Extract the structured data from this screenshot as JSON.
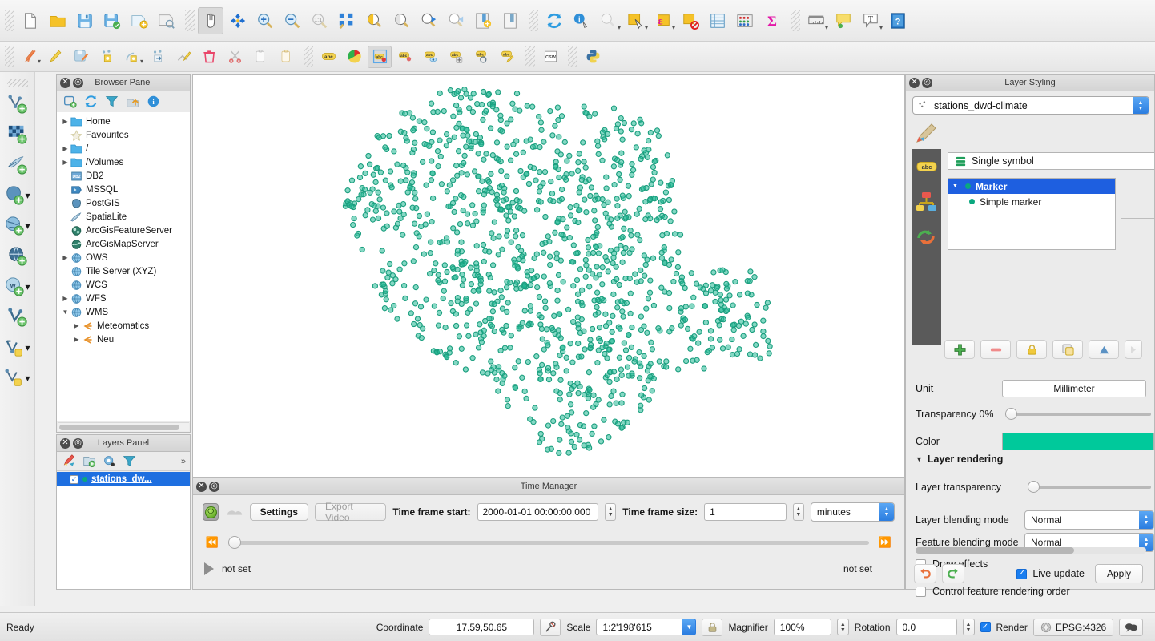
{
  "toolbar_row_1": [
    {
      "name": "new-project-icon",
      "label": "New Project"
    },
    {
      "name": "open-project-icon",
      "label": "Open Project"
    },
    {
      "name": "save-project-icon",
      "label": "Save Project"
    },
    {
      "name": "save-project-as-icon",
      "label": "Save Project As"
    },
    {
      "name": "new-print-composer-icon",
      "label": "New Print Composer"
    },
    {
      "name": "composer-manager-icon",
      "label": "Composer Manager"
    },
    {
      "name": "pan-map-icon",
      "label": "Pan Map"
    },
    {
      "name": "pan-to-selection-icon",
      "label": "Pan Map to Selection"
    },
    {
      "name": "zoom-in-icon",
      "label": "Zoom In"
    },
    {
      "name": "zoom-out-icon",
      "label": "Zoom Out"
    },
    {
      "name": "zoom-native-icon",
      "label": "Zoom to Native Resolution"
    },
    {
      "name": "zoom-full-icon",
      "label": "Zoom Full"
    },
    {
      "name": "zoom-to-selection-icon",
      "label": "Zoom to Selection"
    },
    {
      "name": "zoom-to-layer-icon",
      "label": "Zoom to Layer"
    },
    {
      "name": "zoom-last-icon",
      "label": "Zoom Last"
    },
    {
      "name": "zoom-next-icon",
      "label": "Zoom Next"
    },
    {
      "name": "new-bookmark-icon",
      "label": "New Bookmark"
    },
    {
      "name": "show-bookmarks-icon",
      "label": "Show Bookmarks"
    },
    {
      "name": "refresh-icon",
      "label": "Refresh"
    },
    {
      "name": "identify-features-icon",
      "label": "Identify Features"
    },
    {
      "name": "measure-line-icon",
      "label": "Measure Line"
    },
    {
      "name": "select-features-icon",
      "label": "Select Features"
    },
    {
      "name": "select-by-expression-icon",
      "label": "Select by Expression"
    },
    {
      "name": "deselect-features-icon",
      "label": "Deselect Features"
    },
    {
      "name": "open-attribute-table-icon",
      "label": "Open Attribute Table"
    },
    {
      "name": "field-calculator-icon",
      "label": "Open Field Calculator"
    },
    {
      "name": "statistical-summary-icon",
      "label": "Statistical Summary"
    },
    {
      "name": "measure-icon",
      "label": "Measure"
    },
    {
      "name": "map-tips-icon",
      "label": "Show Map Tips"
    },
    {
      "name": "text-annotation-icon",
      "label": "Text Annotation"
    },
    {
      "name": "help-icon",
      "label": "Help"
    }
  ],
  "toolbar_row_2": [
    {
      "name": "current-edits-icon",
      "label": "Current Edits"
    },
    {
      "name": "toggle-editing-icon",
      "label": "Toggle Editing"
    },
    {
      "name": "save-layer-edits-icon",
      "label": "Save Layer Edits"
    },
    {
      "name": "add-feature-icon",
      "label": "Add Feature"
    },
    {
      "name": "node-tool-icon",
      "label": "Node Tool"
    },
    {
      "name": "move-feature-icon",
      "label": "Move Feature"
    },
    {
      "name": "modify-attributes-icon",
      "label": "Modify Attributes of Selected Features"
    },
    {
      "name": "delete-selected-icon",
      "label": "Delete Selected"
    },
    {
      "name": "cut-features-icon",
      "label": "Cut Features"
    },
    {
      "name": "copy-features-icon",
      "label": "Copy Features"
    },
    {
      "name": "paste-features-icon",
      "label": "Paste Features"
    },
    {
      "name": "label-icon",
      "label": "Layer Labeling Options"
    },
    {
      "name": "style-manager-icon",
      "label": "Style Manager"
    },
    {
      "name": "highlight-pinned-labels-icon",
      "label": "Highlight Pinned Labels"
    },
    {
      "name": "pin-labels-icon",
      "label": "Pin/Unpin Labels"
    },
    {
      "name": "show-hide-labels-icon",
      "label": "Show/Hide Labels"
    },
    {
      "name": "move-label-icon",
      "label": "Move Label"
    },
    {
      "name": "rotate-label-icon",
      "label": "Rotate Label"
    },
    {
      "name": "change-label-icon",
      "label": "Change Label"
    },
    {
      "name": "csw-icon",
      "label": "MetaSearch (CSW)"
    },
    {
      "name": "python-console-icon",
      "label": "Python Console"
    }
  ],
  "left_toolbar": [
    {
      "name": "add-vector-layer-icon",
      "label": "Add Vector Layer"
    },
    {
      "name": "add-raster-layer-icon",
      "label": "Add Raster Layer"
    },
    {
      "name": "add-delimited-text-layer-icon",
      "label": "Add Delimited Text Layer"
    },
    {
      "name": "add-postgis-layer-icon",
      "label": "Add PostGIS Layer"
    },
    {
      "name": "add-spatialite-layer-icon",
      "label": "Add SpatiaLite Layer"
    },
    {
      "name": "add-wms-layer-icon",
      "label": "Add WMS/WMTS Layer"
    },
    {
      "name": "add-wcs-layer-icon",
      "label": "Add WCS Layer"
    },
    {
      "name": "add-wfs-layer-icon",
      "label": "Add WFS Layer"
    },
    {
      "name": "add-virtual-layer-icon",
      "label": "Add Virtual Layer"
    },
    {
      "name": "new-shapefile-layer-icon",
      "label": "New Shapefile Layer"
    }
  ],
  "browser_panel": {
    "title": "Browser Panel",
    "toolbar": [
      {
        "name": "add-selected-layers-icon",
        "label": "Add Selected Layers"
      },
      {
        "name": "refresh-icon",
        "label": "Refresh"
      },
      {
        "name": "filter-browser-icon",
        "label": "Filter Browser"
      },
      {
        "name": "collapse-all-icon",
        "label": "Collapse All"
      },
      {
        "name": "properties-icon",
        "label": "Properties"
      }
    ],
    "tree": [
      {
        "label": "Home",
        "icon": "folder-icon",
        "twisty": "collapsed",
        "indent": 0
      },
      {
        "label": "Favourites",
        "icon": "star-icon",
        "twisty": "none",
        "indent": 0
      },
      {
        "label": "/",
        "icon": "folder-icon",
        "twisty": "collapsed",
        "indent": 0
      },
      {
        "label": "/Volumes",
        "icon": "folder-icon",
        "twisty": "collapsed",
        "indent": 0
      },
      {
        "label": "DB2",
        "icon": "db2-icon",
        "twisty": "none",
        "indent": 0
      },
      {
        "label": "MSSQL",
        "icon": "mssql-icon",
        "twisty": "none",
        "indent": 0
      },
      {
        "label": "PostGIS",
        "icon": "postgis-icon",
        "twisty": "none",
        "indent": 0
      },
      {
        "label": "SpatiaLite",
        "icon": "spatialite-icon",
        "twisty": "none",
        "indent": 0
      },
      {
        "label": "ArcGisFeatureServer",
        "icon": "arcgis-feature-server-icon",
        "twisty": "none",
        "indent": 0
      },
      {
        "label": "ArcGisMapServer",
        "icon": "arcgis-map-server-icon",
        "twisty": "none",
        "indent": 0
      },
      {
        "label": "OWS",
        "icon": "globe-icon",
        "twisty": "collapsed",
        "indent": 0
      },
      {
        "label": "Tile Server (XYZ)",
        "icon": "globe-icon",
        "twisty": "none",
        "indent": 0
      },
      {
        "label": "WCS",
        "icon": "globe-icon",
        "twisty": "none",
        "indent": 0
      },
      {
        "label": "WFS",
        "icon": "globe-icon",
        "twisty": "collapsed",
        "indent": 0
      },
      {
        "label": "WMS",
        "icon": "globe-icon",
        "twisty": "expanded",
        "indent": 0
      },
      {
        "label": "Meteomatics",
        "icon": "wms-connection-icon",
        "twisty": "collapsed",
        "indent": 1
      },
      {
        "label": "Neu",
        "icon": "wms-connection-icon",
        "twisty": "collapsed",
        "indent": 1
      }
    ]
  },
  "layers_panel": {
    "title": "Layers Panel",
    "toolbar": [
      {
        "name": "open-layer-styling-panel-icon",
        "label": "Open Layer Styling Panel"
      },
      {
        "name": "add-group-icon",
        "label": "Add Group"
      },
      {
        "name": "manage-layer-visibility-icon",
        "label": "Manage Layer Visibility"
      },
      {
        "name": "filter-legend-icon",
        "label": "Filter Legend"
      }
    ],
    "overflow_label": "»",
    "layers": [
      {
        "name": "stations_dw...",
        "checked": true,
        "symbol_color": "#0aa87f"
      }
    ]
  },
  "map": {
    "layer_name": "stations_dwd-climate",
    "point_color": "#1a9e7e",
    "point_fill": "#21b894",
    "background": "#ffffff"
  },
  "time_manager": {
    "title": "Time Manager",
    "power_button": "power-toggle",
    "settings_label": "Settings",
    "export_video_label": "Export Video",
    "time_frame_start_label": "Time frame start:",
    "time_frame_start_value": "2000-01-01 00:00:00.000",
    "time_frame_size_label": "Time frame size:",
    "time_frame_size_value": "1",
    "time_unit_value": "minutes",
    "slider_position_percent": 0,
    "left_status": "not set",
    "right_status": "not set"
  },
  "layer_styling": {
    "title": "Layer Styling",
    "layer_selector_value": "stations_dwd-climate",
    "side_tabs": [
      {
        "name": "symbology-tab",
        "label": "Symbology"
      },
      {
        "name": "labels-tab",
        "label": "Labels"
      },
      {
        "name": "diagrams-tab",
        "label": "Diagrams"
      },
      {
        "name": "history-tab",
        "label": "History"
      }
    ],
    "renderer_value": "Single symbol",
    "symbol_tree": [
      {
        "label": "Marker",
        "selected": true,
        "child": false
      },
      {
        "label": "Simple marker",
        "selected": false,
        "child": true
      }
    ],
    "symbol_buttons": [
      {
        "name": "add-symbol-layer-button",
        "label": "+"
      },
      {
        "name": "remove-symbol-layer-button",
        "label": "−"
      },
      {
        "name": "lock-layer-button",
        "label": "lock"
      },
      {
        "name": "duplicate-layer-button",
        "label": "duplicate"
      },
      {
        "name": "move-up-button",
        "label": "up"
      },
      {
        "name": "move-down-button",
        "label": "down"
      }
    ],
    "unit_label": "Unit",
    "unit_value": "Millimeter",
    "transparency_label": "Transparency 0%",
    "transparency_percent": 0,
    "color_label": "Color",
    "color_value": "#00C99B",
    "layer_rendering_label": "Layer rendering",
    "layer_transparency_label": "Layer transparency",
    "layer_transparency_percent": 0,
    "layer_blending_label": "Layer blending mode",
    "layer_blending_value": "Normal",
    "feature_blending_label": "Feature blending mode",
    "feature_blending_value": "Normal",
    "draw_effects_label": "Draw effects",
    "draw_effects_checked": false,
    "control_render_order_label": "Control feature rendering order",
    "control_render_order_checked": false,
    "undo_label": "Undo",
    "redo_label": "Redo",
    "live_update_label": "Live update",
    "live_update_checked": true,
    "apply_label": "Apply"
  },
  "status_bar": {
    "ready_label": "Ready",
    "coordinate_label": "Coordinate",
    "coordinate_value": "17.59,50.65",
    "toggle_extents_name": "toggle-extents-icon",
    "scale_label": "Scale",
    "scale_value": "1:2'198'615",
    "lock_scale_name": "lock-scale-icon",
    "magnifier_label": "Magnifier",
    "magnifier_value": "100%",
    "rotation_label": "Rotation",
    "rotation_value": "0.0",
    "render_label": "Render",
    "render_checked": true,
    "crs_value": "EPSG:4326",
    "messages_name": "messages-icon"
  }
}
